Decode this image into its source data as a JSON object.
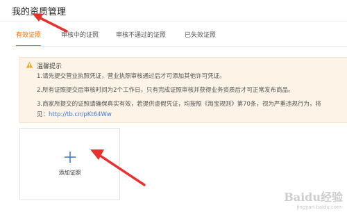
{
  "page": {
    "title": "我的资质管理"
  },
  "tabs": [
    {
      "label": "有效证照",
      "active": true
    },
    {
      "label": "审核中的证照",
      "active": false
    },
    {
      "label": "审核不通过的证照",
      "active": false
    },
    {
      "label": "已失效证照",
      "active": false
    }
  ],
  "notice": {
    "title": "温馨提示",
    "lines": [
      "1.请先提交营业执照凭证，营业执照审核通过后才可添加其他许可凭证。",
      "2.所有证照提交后审核时间为2个工作日，只有完成证照审核并获得业务资质后才可正常发布商品。",
      "3.商家所提交的证照请确保真实有效，若提供虚假凭证，均按照《淘宝规则》第70条，视为严重违规行为，将"
    ],
    "line4_prefix": "见：",
    "link": "http://tb.cn/pKt64Ww"
  },
  "add_card": {
    "label": "添加证照"
  },
  "watermark": {
    "text": "Baidu经验",
    "sub": "jingyan.baidu.com"
  },
  "colors": {
    "accent": "#ff6a00",
    "link": "#3b7bd1",
    "arrow": "#e8312f",
    "notice_bg": "#fdf3e7"
  },
  "icons": {
    "warning": "warning-triangle-icon",
    "add": "plus-icon"
  }
}
